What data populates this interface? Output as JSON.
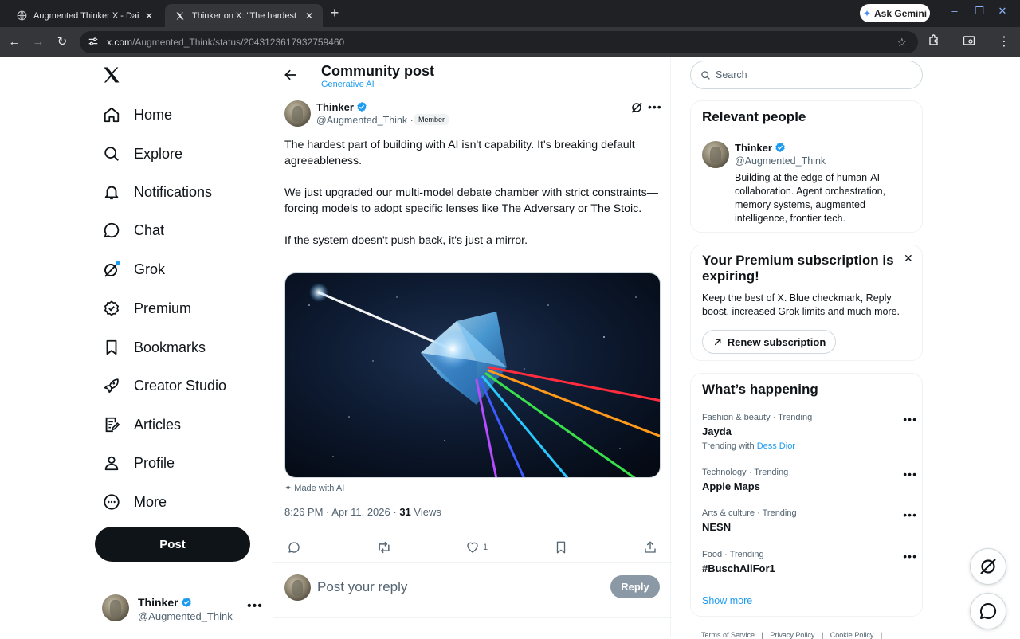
{
  "browser": {
    "tabs": [
      {
        "title": "Augmented Thinker X - Daily Po",
        "active": false
      },
      {
        "title": "Thinker on X: \"The hardest part",
        "active": true
      }
    ],
    "ask_gemini": "Ask Gemini",
    "url_host": "x.com",
    "url_path": "/Augmented_Think/status/2043123617932759460"
  },
  "nav": {
    "items": [
      {
        "label": "Home",
        "icon": "home-icon"
      },
      {
        "label": "Explore",
        "icon": "search-icon"
      },
      {
        "label": "Notifications",
        "icon": "bell-icon"
      },
      {
        "label": "Chat",
        "icon": "chat-icon"
      },
      {
        "label": "Grok",
        "icon": "grok-icon"
      },
      {
        "label": "Premium",
        "icon": "premium-icon"
      },
      {
        "label": "Bookmarks",
        "icon": "bookmark-icon"
      },
      {
        "label": "Creator Studio",
        "icon": "rocket-icon"
      },
      {
        "label": "Articles",
        "icon": "articles-icon"
      },
      {
        "label": "Profile",
        "icon": "person-icon"
      },
      {
        "label": "More",
        "icon": "more-circle-icon"
      }
    ],
    "post_label": "Post",
    "account": {
      "name": "Thinker",
      "handle": "@Augmented_Think"
    }
  },
  "post": {
    "header_title": "Community post",
    "community": "Generative AI",
    "author": {
      "name": "Thinker",
      "handle": "@Augmented_Think",
      "separator": "·",
      "badge": "Member"
    },
    "paragraphs": [
      "The hardest part of building with AI isn't capability. It's breaking default agreeableness.",
      "We just upgraded our multi-model debate chamber with strict constraints—forcing models to adopt specific lenses like The Adversary or The Stoic.",
      "If the system doesn't push back, it's just a mirror."
    ],
    "made_with_ai": "Made with AI",
    "time": "8:26 PM",
    "date": "Apr 11, 2026",
    "views_count": "31",
    "views_label": "Views",
    "likes": "1",
    "reply_placeholder": "Post your reply",
    "reply_button": "Reply"
  },
  "sidebar": {
    "search_placeholder": "Search",
    "relevant": {
      "title": "Relevant people",
      "name": "Thinker",
      "handle": "@Augmented_Think",
      "bio": "Building at the edge of human-AI collaboration. Agent orchestration, memory systems, augmented intelligence, frontier tech."
    },
    "premium": {
      "title": "Your Premium subscription is expiring!",
      "text": "Keep the best of X. Blue checkmark, Reply boost, increased Grok limits and much more.",
      "button": "Renew subscription"
    },
    "happening": {
      "title": "What’s happening",
      "trends": [
        {
          "category": "Fashion & beauty · Trending",
          "title": "Jayda",
          "with_prefix": "Trending with",
          "with_link": "Dess Dior"
        },
        {
          "category": "Technology · Trending",
          "title": "Apple Maps"
        },
        {
          "category": "Arts & culture · Trending",
          "title": "NESN"
        },
        {
          "category": "Food · Trending",
          "title": "#BuschAllFor1"
        }
      ],
      "show_more": "Show more"
    },
    "footer": [
      "Terms of Service",
      "|",
      "Privacy Policy",
      "|",
      "Cookie Policy",
      "|"
    ]
  },
  "colors": {
    "accent": "#1d9bf0",
    "text": "#0f1419",
    "muted": "#536471",
    "chrome_dark": "#202124",
    "chrome_mid": "#35363a"
  }
}
